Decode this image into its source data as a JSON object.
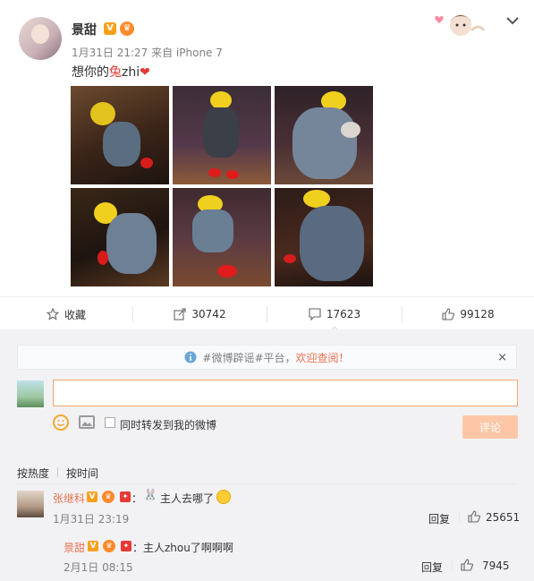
{
  "post": {
    "author": "景甜",
    "meta": "1月31日 21:27 来自 iPhone 7",
    "text_before": "想你的",
    "text_highlight": "兔",
    "text_after": "zhi",
    "heart": "❤"
  },
  "actions": {
    "favorite": "收藏",
    "repost": "30742",
    "comment": "17623",
    "like": "99128"
  },
  "notice": {
    "prefix": "#微博辟谣#平台，",
    "link": "欢迎查阅！",
    "close": "×"
  },
  "composer": {
    "repost_label": "同时转发到我的微博",
    "submit_label": "评论"
  },
  "sort": {
    "hot": "按热度",
    "time": "按时间"
  },
  "comments": [
    {
      "name": "张继科",
      "text": "主人去哪了",
      "time": "1月31日 23:19",
      "reply": "回复",
      "likes": "25651"
    }
  ],
  "replies": [
    {
      "name": "景甜",
      "text": "主人zhou了啊啊啊",
      "time": "2月1日 08:15",
      "reply": "回复",
      "likes": "7945"
    }
  ],
  "icons": {
    "verified": "V",
    "colors": {
      "accent": "#eb7350",
      "verified": "#f9a01b",
      "like_highlight": "#e53935"
    }
  }
}
